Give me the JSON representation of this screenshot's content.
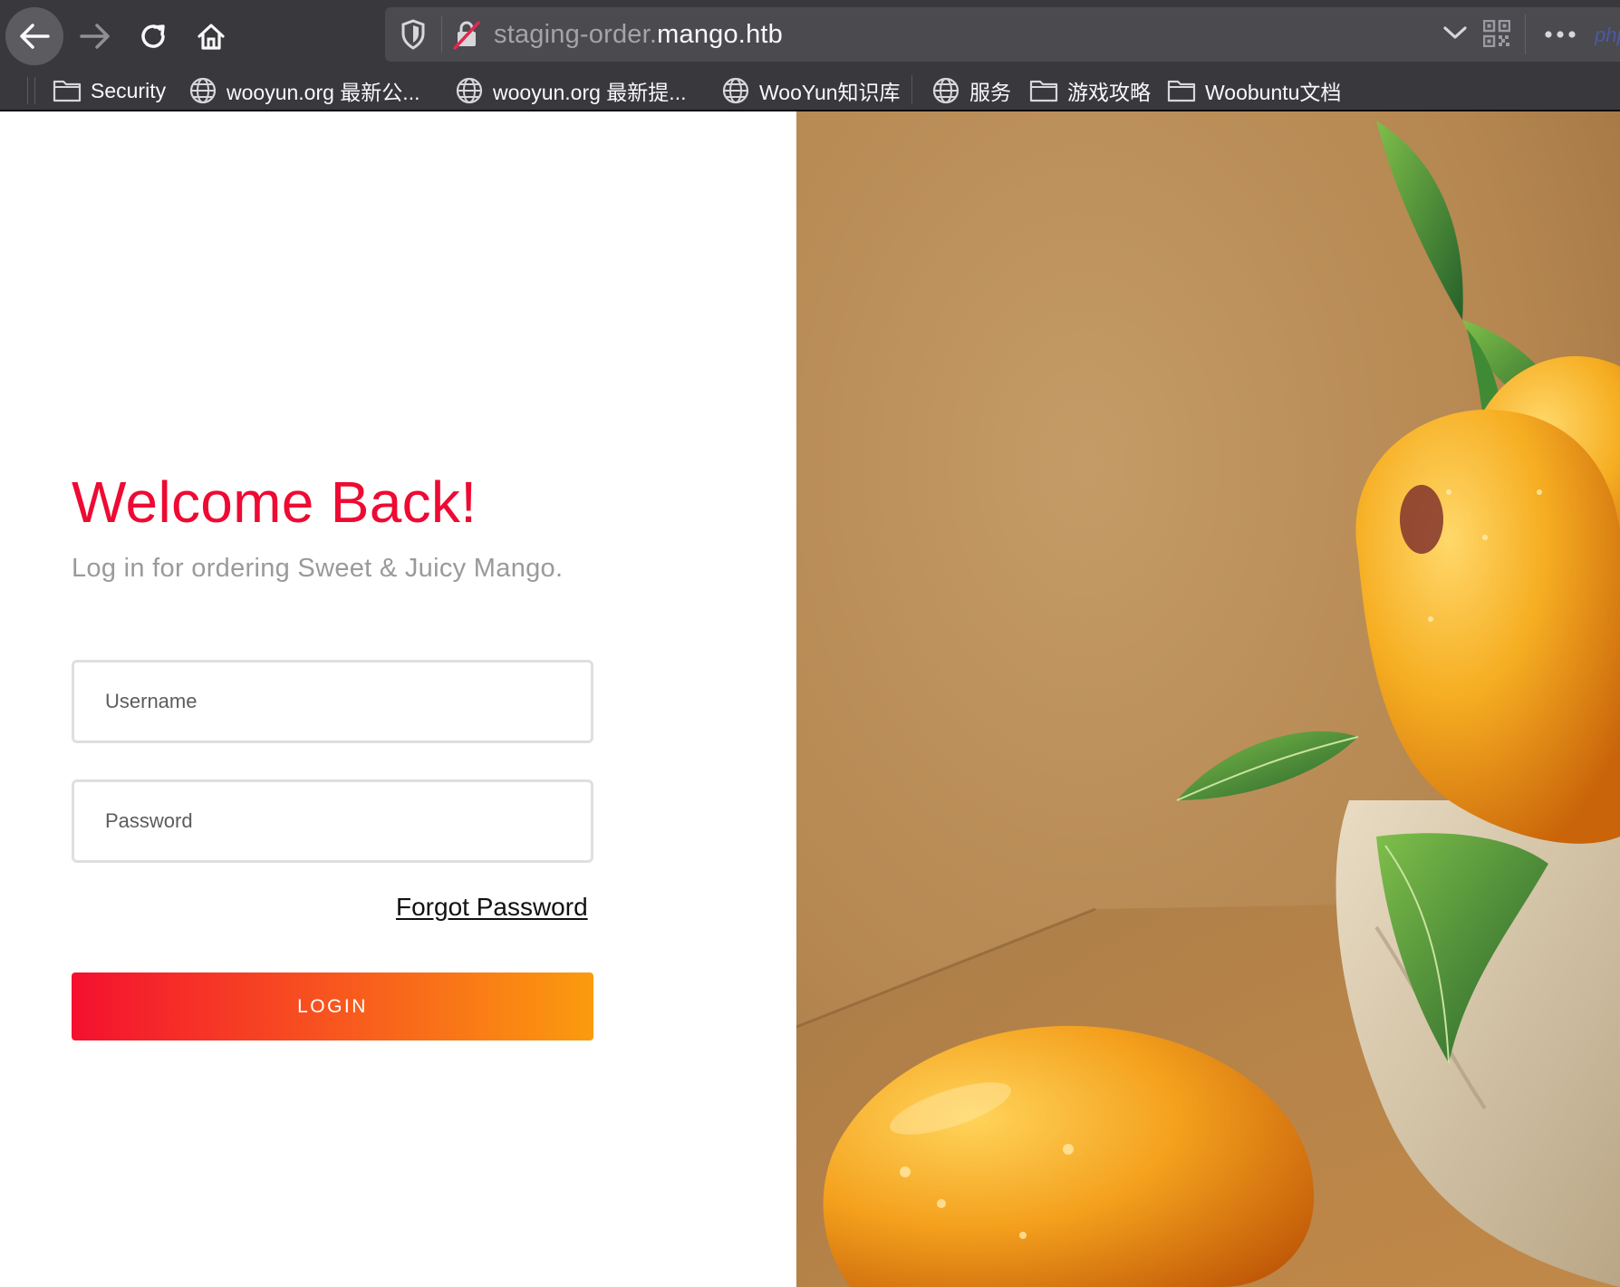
{
  "browser": {
    "url_prefix": "staging-order.",
    "url_domain": "mango.htb",
    "url_overflow_text": "php",
    "bookmarks": [
      {
        "label": "Security",
        "icon": "folder-icon"
      },
      {
        "label": "wooyun.org 最新公...",
        "icon": "globe-icon"
      },
      {
        "label": "wooyun.org 最新提...",
        "icon": "globe-icon"
      },
      {
        "label": "WooYun知识库",
        "icon": "globe-icon"
      },
      {
        "label": "服务",
        "icon": "globe-icon"
      },
      {
        "label": "游戏攻略",
        "icon": "folder-icon"
      },
      {
        "label": "Woobuntu文档",
        "icon": "folder-icon"
      }
    ]
  },
  "login": {
    "title": "Welcome Back!",
    "subtitle": "Log in for ordering Sweet & Juicy Mango.",
    "username_placeholder": "Username",
    "password_placeholder": "Password",
    "forgot_label": "Forgot Password",
    "login_label": "LOGIN"
  },
  "colors": {
    "title_red": "#ee0a33",
    "button_gradient_start": "#f4102f",
    "button_gradient_end": "#fb9b0e",
    "chrome_dark": "#38383d"
  },
  "hero_image": {
    "subject": "mango-still-life"
  }
}
